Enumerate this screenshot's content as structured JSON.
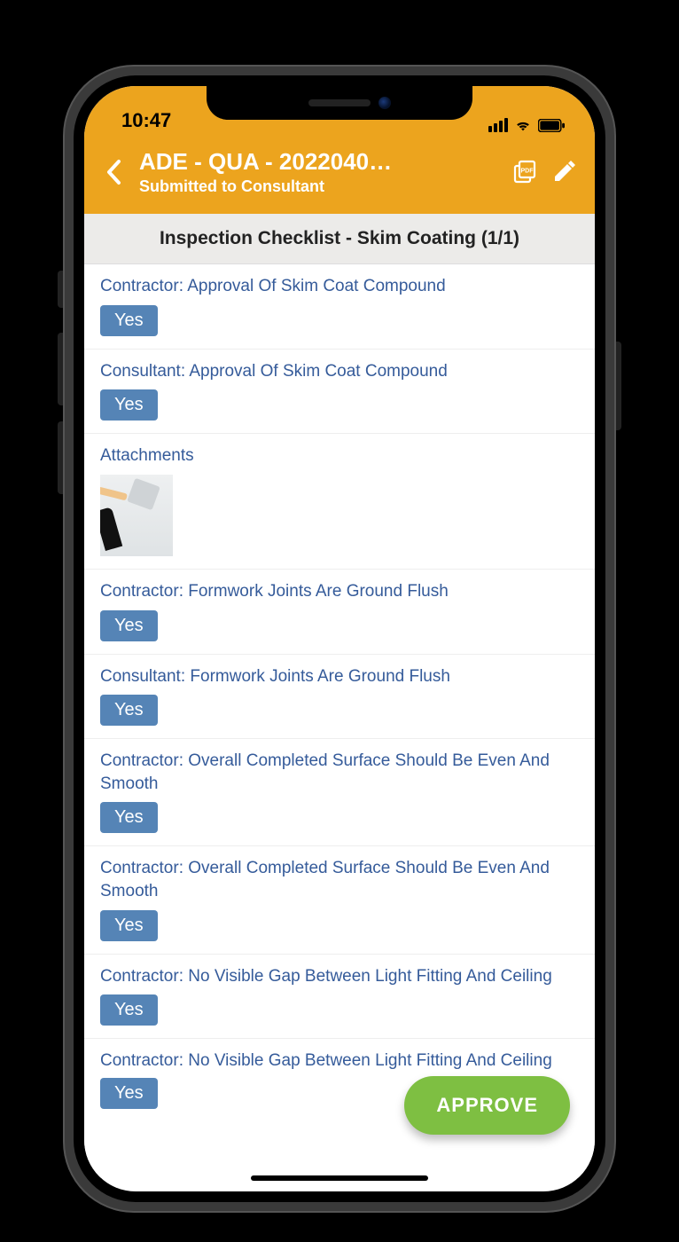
{
  "status": {
    "time": "10:47"
  },
  "header": {
    "title": "ADE - QUA - 2022040…",
    "subtitle": "Submitted to Consultant"
  },
  "section": {
    "title": "Inspection Checklist - Skim Coating (1/1)"
  },
  "items": [
    {
      "label": "Contractor: Approval Of Skim Coat Compound",
      "value": "Yes"
    },
    {
      "label": "Consultant: Approval Of Skim Coat Compound",
      "value": "Yes"
    },
    {
      "label": "Attachments",
      "type": "attachments"
    },
    {
      "label": "Contractor: Formwork Joints Are Ground Flush",
      "value": "Yes"
    },
    {
      "label": "Consultant: Formwork Joints Are Ground Flush",
      "value": "Yes"
    },
    {
      "label": "Contractor: Overall Completed Surface Should Be Even And Smooth",
      "value": "Yes"
    },
    {
      "label": "Contractor: Overall Completed Surface Should Be Even And Smooth",
      "value": "Yes"
    },
    {
      "label": "Contractor: No Visible Gap Between Light Fitting And Ceiling",
      "value": "Yes"
    },
    {
      "label": "Contractor: No Visible Gap Between Light Fitting And Ceiling",
      "value": "Yes"
    }
  ],
  "approve": {
    "label": "APPROVE"
  }
}
